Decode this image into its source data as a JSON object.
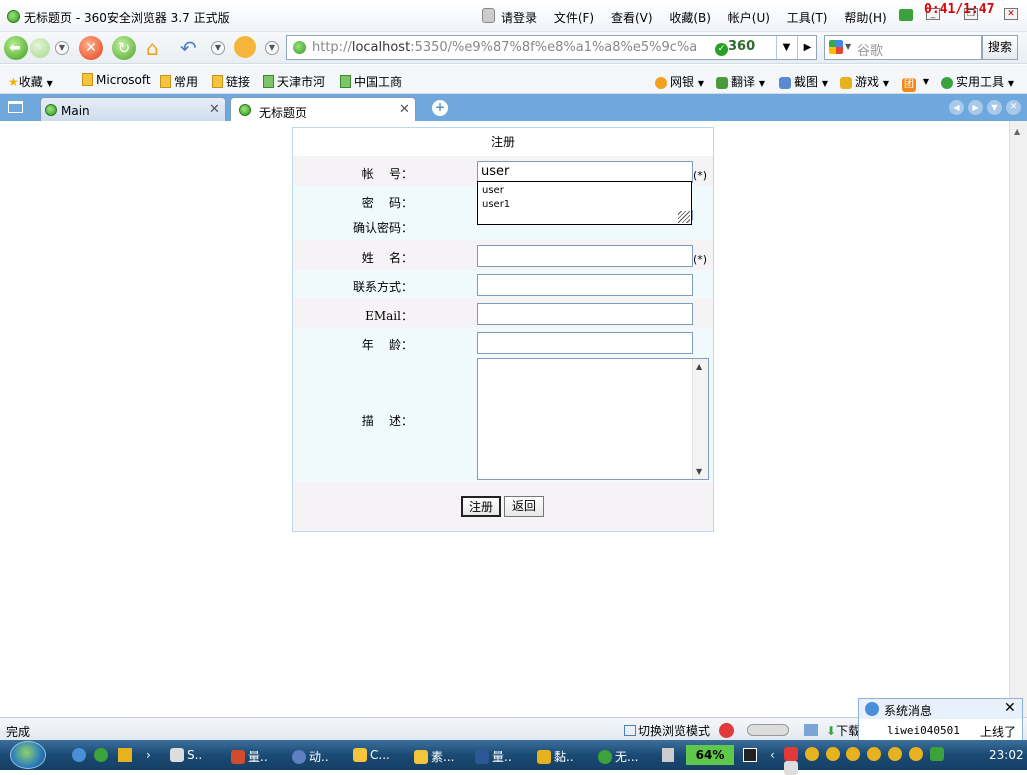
{
  "window": {
    "title": "无标题页 - 360安全浏览器 3.7 正式版",
    "menu": [
      "请登录",
      "文件(F)",
      "查看(V)",
      "收藏(B)",
      "帐户(U)",
      "工具(T)",
      "帮助(H)"
    ],
    "overlay_timer": "0:41/1:47"
  },
  "nav": {
    "url_prefix": "http://",
    "url_host": "localhost",
    "url_rest": ":5350/%e9%87%8f%e8%a1%a8%e5%9c%a8",
    "security_badge": "360",
    "search_placeholder": "谷歌",
    "search_button": "搜索"
  },
  "favorites": {
    "left": [
      "收藏",
      "Microsoft",
      "常用",
      "链接",
      "天津市河",
      "中国工商"
    ],
    "right": [
      "网银",
      "翻译",
      "截图",
      "游戏",
      "团",
      "实用工具"
    ]
  },
  "tabs": [
    {
      "label": "Main",
      "active": false
    },
    {
      "label": "无标题页",
      "active": true
    }
  ],
  "form": {
    "title": "注册",
    "fields": {
      "account": {
        "label": "帐    号：",
        "value": "user",
        "required": "(*)"
      },
      "password": {
        "label": "密    码："
      },
      "confirm": {
        "label": "确认密码："
      },
      "name": {
        "label": "姓    名：",
        "required": "(*)"
      },
      "contact": {
        "label": "联系方式："
      },
      "email": {
        "label": "EMail："
      },
      "age": {
        "label": "年    龄："
      },
      "desc": {
        "label": "描    述："
      }
    },
    "autocomplete": [
      "user",
      "user1"
    ],
    "buttons": {
      "submit": "注册",
      "back": "返回"
    }
  },
  "status": {
    "left": "完成",
    "mode": "切换浏览模式",
    "download": "下载"
  },
  "popup": {
    "title": "系统消息",
    "user": "liwei040501",
    "message": "上线了"
  },
  "taskbar": {
    "items": [
      "S..",
      "量..",
      "动..",
      "C...",
      "素...",
      "量..",
      "黏..",
      "无..."
    ],
    "battery": "64%",
    "clock": "23:02"
  },
  "colors": {
    "tabbar": "#6fa8dc",
    "form_border": "#bcd8ea",
    "row_pink": "#f6f3f6",
    "row_blue": "#f0fafd",
    "taskbar": "#1a4a74"
  }
}
